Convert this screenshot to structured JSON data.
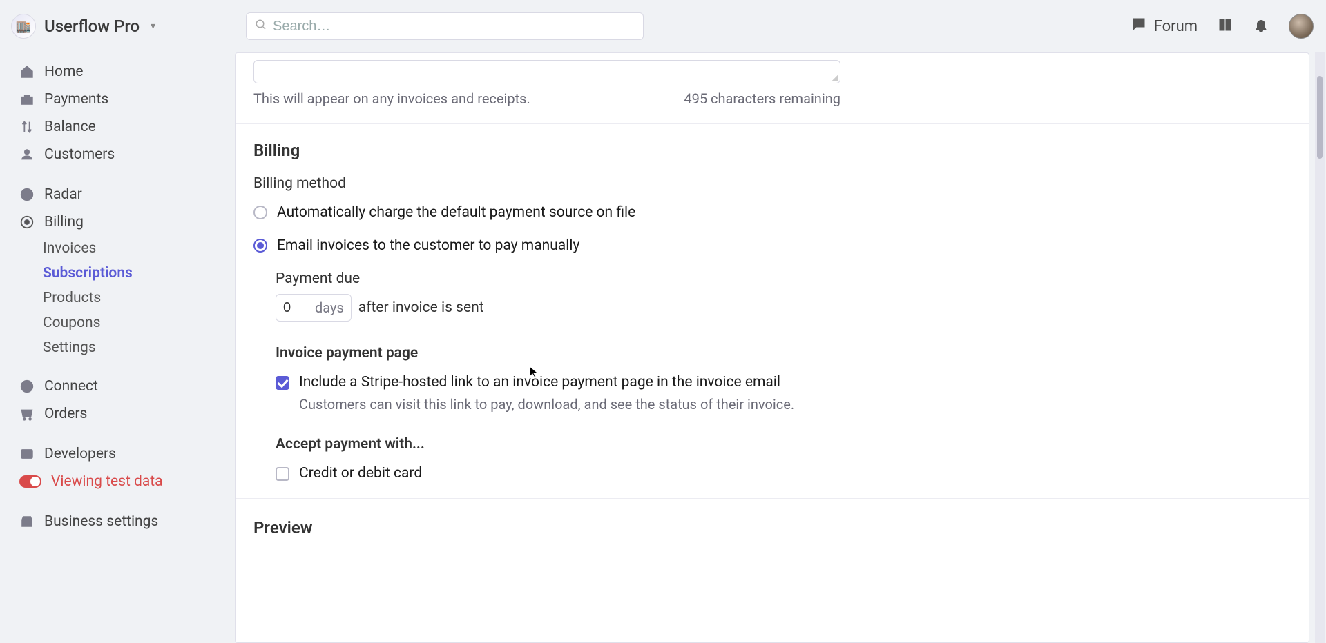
{
  "header": {
    "app_name": "Userflow Pro",
    "search_placeholder": "Search…",
    "forum_label": "Forum"
  },
  "sidebar": {
    "items": [
      {
        "label": "Home"
      },
      {
        "label": "Payments"
      },
      {
        "label": "Balance"
      },
      {
        "label": "Customers"
      }
    ],
    "group2": [
      {
        "label": "Radar"
      },
      {
        "label": "Billing"
      }
    ],
    "billing_sub": [
      {
        "label": "Invoices"
      },
      {
        "label": "Subscriptions"
      },
      {
        "label": "Products"
      },
      {
        "label": "Coupons"
      },
      {
        "label": "Settings"
      }
    ],
    "group3": [
      {
        "label": "Connect"
      },
      {
        "label": "Orders"
      }
    ],
    "group4": [
      {
        "label": "Developers"
      },
      {
        "label": "Viewing test data",
        "danger": true
      }
    ],
    "business_settings": "Business settings"
  },
  "main": {
    "memo_hint": "This will appear on any invoices and receipts.",
    "memo_remaining": "495 characters remaining",
    "billing_title": "Billing",
    "billing_method_label": "Billing method",
    "radio_auto": "Automatically charge the default payment source on file",
    "radio_email": "Email invoices to the customer to pay manually",
    "payment_due_label": "Payment due",
    "days_value": "0",
    "days_unit": "days",
    "after_invoice_text": "after invoice is sent",
    "invoice_page_heading": "Invoice payment page",
    "include_link_label": "Include a Stripe-hosted link to an invoice payment page in the invoice email",
    "include_link_desc": "Customers can visit this link to pay, download, and see the status of their invoice.",
    "accept_heading": "Accept payment with...",
    "credit_card_label": "Credit or debit card",
    "preview_title": "Preview"
  }
}
